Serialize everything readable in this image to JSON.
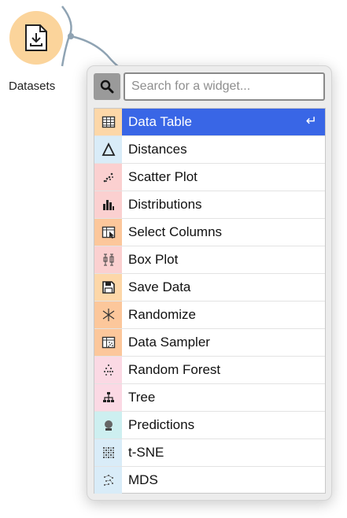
{
  "canvas": {
    "node_label": "Datasets",
    "node_color": "#fbd49b"
  },
  "popup": {
    "search_placeholder": "Search for a widget...",
    "search_value": "",
    "enter_symbol": "↵",
    "items": [
      {
        "label": "Data Table",
        "icon": "data-table-icon",
        "bg": "#fdd7a8",
        "selected": true
      },
      {
        "label": "Distances",
        "icon": "distances-icon",
        "bg": "#d9ecf8"
      },
      {
        "label": "Scatter Plot",
        "icon": "scatter-plot-icon",
        "bg": "#fbd0d0"
      },
      {
        "label": "Distributions",
        "icon": "distributions-icon",
        "bg": "#fbd0d0"
      },
      {
        "label": "Select Columns",
        "icon": "select-columns-icon",
        "bg": "#fcc79b"
      },
      {
        "label": "Box Plot",
        "icon": "box-plot-icon",
        "bg": "#fbd0d0"
      },
      {
        "label": "Save Data",
        "icon": "save-data-icon",
        "bg": "#fdd7a8"
      },
      {
        "label": "Randomize",
        "icon": "randomize-icon",
        "bg": "#fcc79b"
      },
      {
        "label": "Data Sampler",
        "icon": "data-sampler-icon",
        "bg": "#fcc79b"
      },
      {
        "label": "Random Forest",
        "icon": "random-forest-icon",
        "bg": "#fbd9e4"
      },
      {
        "label": "Tree",
        "icon": "tree-icon",
        "bg": "#fbd9e4"
      },
      {
        "label": "Predictions",
        "icon": "predictions-icon",
        "bg": "#cdeff0"
      },
      {
        "label": "t-SNE",
        "icon": "t-sne-icon",
        "bg": "#d9ecf8"
      },
      {
        "label": "MDS",
        "icon": "mds-icon",
        "bg": "#d9ecf8"
      }
    ]
  }
}
